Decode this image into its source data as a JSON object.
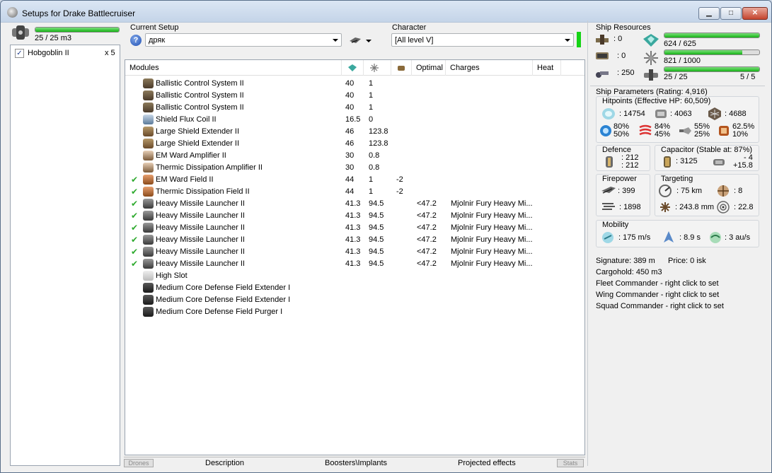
{
  "window": {
    "title": "Setups for Drake Battlecruiser",
    "min_icon": "minimize-icon",
    "max_icon": "maximize-icon",
    "close_icon": "close-icon"
  },
  "drones": {
    "bandwidth_text": "25 / 25 m3",
    "bandwidth_fill": 1.0,
    "items": [
      {
        "name": "Hobgoblin II",
        "count": "x 5",
        "checked": true
      }
    ],
    "tab_label": "Drones"
  },
  "setup": {
    "label": "Current Setup",
    "value": "дряк",
    "help_icon": "help-icon"
  },
  "character": {
    "label": "Character",
    "value": "[All level V]"
  },
  "modules": {
    "headers": {
      "name": "Modules",
      "optimal": "Optimal",
      "charges": "Charges",
      "heat": "Heat"
    },
    "rows": [
      {
        "check": false,
        "name": "Ballistic Control System II",
        "cpu": "40",
        "pg": "1",
        "cap": "",
        "optimal": "",
        "charges": "",
        "icon": "ballistic-icon"
      },
      {
        "check": false,
        "name": "Ballistic Control System II",
        "cpu": "40",
        "pg": "1",
        "cap": "",
        "optimal": "",
        "charges": "",
        "icon": "ballistic-icon"
      },
      {
        "check": false,
        "name": "Ballistic Control System II",
        "cpu": "40",
        "pg": "1",
        "cap": "",
        "optimal": "",
        "charges": "",
        "icon": "ballistic-icon"
      },
      {
        "check": false,
        "name": "Shield Flux Coil II",
        "cpu": "16.5",
        "pg": "0",
        "cap": "",
        "optimal": "",
        "charges": "",
        "icon": "shield-flux-icon"
      },
      {
        "check": false,
        "name": "Large Shield Extender II",
        "cpu": "46",
        "pg": "123.8",
        "cap": "",
        "optimal": "",
        "charges": "",
        "icon": "shield-extender-icon"
      },
      {
        "check": false,
        "name": "Large Shield Extender II",
        "cpu": "46",
        "pg": "123.8",
        "cap": "",
        "optimal": "",
        "charges": "",
        "icon": "shield-extender-icon"
      },
      {
        "check": false,
        "name": "EM Ward Amplifier II",
        "cpu": "30",
        "pg": "0.8",
        "cap": "",
        "optimal": "",
        "charges": "",
        "icon": "amplifier-icon"
      },
      {
        "check": false,
        "name": "Thermic Dissipation Amplifier II",
        "cpu": "30",
        "pg": "0.8",
        "cap": "",
        "optimal": "",
        "charges": "",
        "icon": "amplifier-icon"
      },
      {
        "check": true,
        "name": "EM Ward Field II",
        "cpu": "44",
        "pg": "1",
        "cap": "-2",
        "optimal": "",
        "charges": "",
        "icon": "ward-field-icon"
      },
      {
        "check": true,
        "name": "Thermic Dissipation Field II",
        "cpu": "44",
        "pg": "1",
        "cap": "-2",
        "optimal": "",
        "charges": "",
        "icon": "ward-field-icon"
      },
      {
        "check": true,
        "name": "Heavy Missile Launcher II",
        "cpu": "41.3",
        "pg": "94.5",
        "cap": "",
        "optimal": "<47.2",
        "charges": "Mjolnir Fury Heavy Mi...",
        "icon": "launcher-icon"
      },
      {
        "check": true,
        "name": "Heavy Missile Launcher II",
        "cpu": "41.3",
        "pg": "94.5",
        "cap": "",
        "optimal": "<47.2",
        "charges": "Mjolnir Fury Heavy Mi...",
        "icon": "launcher-icon"
      },
      {
        "check": true,
        "name": "Heavy Missile Launcher II",
        "cpu": "41.3",
        "pg": "94.5",
        "cap": "",
        "optimal": "<47.2",
        "charges": "Mjolnir Fury Heavy Mi...",
        "icon": "launcher-icon"
      },
      {
        "check": true,
        "name": "Heavy Missile Launcher II",
        "cpu": "41.3",
        "pg": "94.5",
        "cap": "",
        "optimal": "<47.2",
        "charges": "Mjolnir Fury Heavy Mi...",
        "icon": "launcher-icon"
      },
      {
        "check": true,
        "name": "Heavy Missile Launcher II",
        "cpu": "41.3",
        "pg": "94.5",
        "cap": "",
        "optimal": "<47.2",
        "charges": "Mjolnir Fury Heavy Mi...",
        "icon": "launcher-icon"
      },
      {
        "check": true,
        "name": "Heavy Missile Launcher II",
        "cpu": "41.3",
        "pg": "94.5",
        "cap": "",
        "optimal": "<47.2",
        "charges": "Mjolnir Fury Heavy Mi...",
        "icon": "launcher-icon"
      },
      {
        "check": false,
        "name": "High Slot",
        "cpu": "",
        "pg": "",
        "cap": "",
        "optimal": "",
        "charges": "",
        "icon": "high-slot-icon"
      },
      {
        "check": false,
        "name": "Medium Core Defense Field Extender I",
        "cpu": "",
        "pg": "",
        "cap": "",
        "optimal": "",
        "charges": "",
        "icon": "rig-icon"
      },
      {
        "check": false,
        "name": "Medium Core Defense Field Extender I",
        "cpu": "",
        "pg": "",
        "cap": "",
        "optimal": "",
        "charges": "",
        "icon": "rig-icon"
      },
      {
        "check": false,
        "name": "Medium Core Defense Field Purger I",
        "cpu": "",
        "pg": "",
        "cap": "",
        "optimal": "",
        "charges": "",
        "icon": "rig-icon"
      }
    ]
  },
  "bottom_tabs": {
    "description": "Description",
    "boosters": "Boosters\\Implants",
    "projected": "Projected effects",
    "stats": "Stats"
  },
  "resources": {
    "title": "Ship Resources",
    "turret": ": 0",
    "launcher": ": 0",
    "calibration": ": 250",
    "cpu_text": "624 / 625",
    "cpu_fill": 0.998,
    "pg_text": "821 / 1000",
    "pg_fill": 0.821,
    "drone_bw_text": "25 / 25",
    "drone_count_text": "5 / 5",
    "drone_bw_fill": 1.0
  },
  "params": {
    "title": "Ship Parameters (Rating: 4,916)",
    "hitpoints_title": "Hitpoints (Effective HP: 60,509)",
    "shield_hp": ": 14754",
    "armor_hp": ": 4063",
    "structure_hp": ": 4688",
    "resists": [
      {
        "a": "80%",
        "b": "50%"
      },
      {
        "a": "84%",
        "b": "45%"
      },
      {
        "a": "55%",
        "b": "25%"
      },
      {
        "a": "62.5%",
        "b": "10%"
      }
    ],
    "defence_title": "Defence",
    "defence_a": ": 212",
    "defence_b": ": 212",
    "capacitor_title": "Capacitor (Stable at: 87%)",
    "cap_amount": ": 3125",
    "cap_a": "- 4",
    "cap_b": "+15.8",
    "firepower_title": "Firepower",
    "dps": ": 399",
    "volley": ": 1898",
    "targeting_title": "Targeting",
    "range": ": 75 km",
    "targets": ": 8",
    "sensor": ": 243.8 mm",
    "scan": ": 22.8",
    "mobility_title": "Mobility",
    "speed": ": 175 m/s",
    "align": ": 8.9 s",
    "warp": ": 3 au/s",
    "signature": "Signature: 389 m",
    "price": "Price: 0 isk",
    "cargohold": "Cargohold: 450 m3",
    "fleet": "Fleet Commander - right click to set",
    "wing": "Wing Commander - right click to set",
    "squad": "Squad Commander - right click to set"
  },
  "colors": {
    "accent_green": "#16b316",
    "check_green": "#2eaa2e",
    "title_bar": "#c4d4e8",
    "close_red": "#c4452e"
  }
}
